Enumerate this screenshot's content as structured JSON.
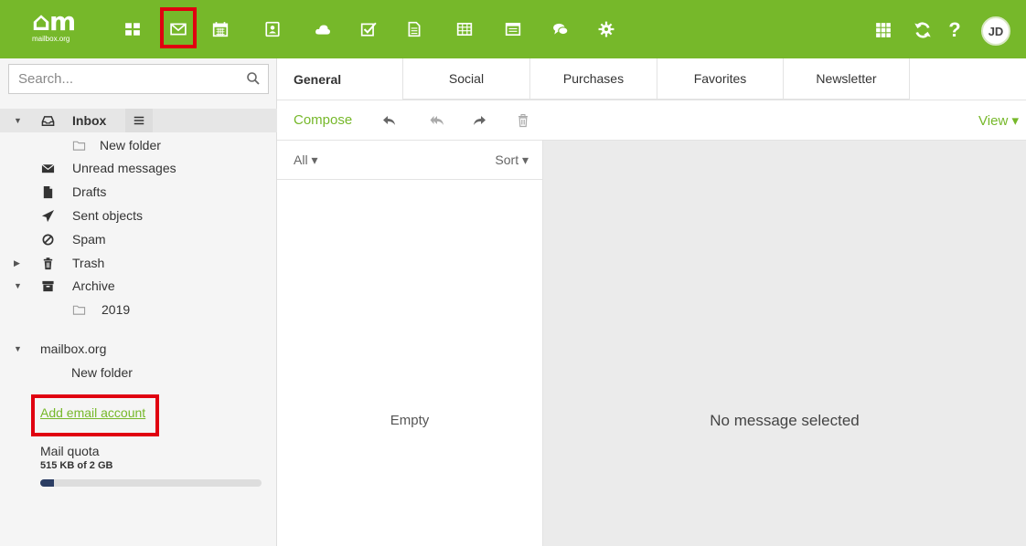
{
  "topbar": {
    "logo_mark": "⌂m",
    "logo_text": "mailbox.org",
    "apps": [
      {
        "icon": "dashboard-icon"
      },
      {
        "icon": "mail-icon"
      },
      {
        "icon": "calendar-icon"
      },
      {
        "icon": "contacts-icon"
      },
      {
        "icon": "cloud-icon"
      },
      {
        "icon": "tasks-icon"
      },
      {
        "icon": "documents-icon"
      },
      {
        "icon": "spreadsheet-icon"
      },
      {
        "icon": "presentation-icon"
      },
      {
        "icon": "chat-icon"
      },
      {
        "icon": "settings-icon"
      }
    ],
    "avatar_initials": "JD",
    "colors": {
      "brand": "#76b82a",
      "highlight": "#e00010"
    }
  },
  "search": {
    "placeholder": "Search..."
  },
  "folders": {
    "inbox": "Inbox",
    "new_folder": "New folder",
    "unread": "Unread messages",
    "drafts": "Drafts",
    "sent": "Sent objects",
    "spam": "Spam",
    "trash": "Trash",
    "archive": "Archive",
    "archive_2019": "2019",
    "account": "mailbox.org",
    "account_new_folder": "New folder"
  },
  "sidebar": {
    "add_account": "Add email account",
    "quota_title": "Mail quota",
    "quota_value": "515 KB of 2 GB",
    "quota_fraction": 0.06
  },
  "tabs": [
    {
      "label": "General"
    },
    {
      "label": "Social"
    },
    {
      "label": "Purchases"
    },
    {
      "label": "Favorites"
    },
    {
      "label": "Newsletter"
    }
  ],
  "toolbar": {
    "compose": "Compose",
    "view": "View ▾"
  },
  "list": {
    "filter": "All ▾",
    "sort": "Sort ▾",
    "empty": "Empty"
  },
  "detail": {
    "placeholder": "No message selected"
  }
}
